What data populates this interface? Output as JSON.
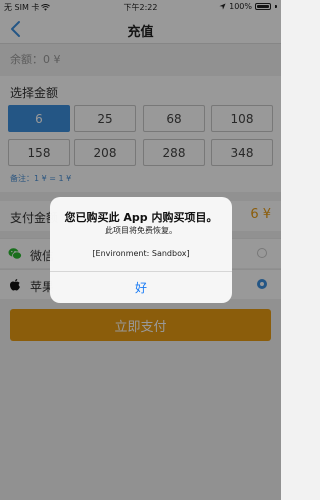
{
  "status_bar": {
    "carrier": "无 SIM 卡",
    "time": "下午2:22",
    "battery": "100%"
  },
  "nav": {
    "title": "充值",
    "back_icon": "chevron-left-icon"
  },
  "balance": {
    "label": "余额：0 ¥"
  },
  "amount_section": {
    "title": "选择金额",
    "options": [
      {
        "label": "6",
        "selected": true
      },
      {
        "label": "25",
        "selected": false
      },
      {
        "label": "68",
        "selected": false
      },
      {
        "label": "108",
        "selected": false
      },
      {
        "label": "158",
        "selected": false
      },
      {
        "label": "208",
        "selected": false
      },
      {
        "label": "288",
        "selected": false
      },
      {
        "label": "348",
        "selected": false
      }
    ],
    "note": "备注：1 ¥ = 1 ¥"
  },
  "pay_amount": {
    "label": "支付金额",
    "value": "6 ¥"
  },
  "methods": [
    {
      "label": "微信",
      "icon": "wechat-icon",
      "checked": false
    },
    {
      "label": "苹果",
      "icon": "apple-icon",
      "checked": true
    }
  ],
  "pay_button": {
    "label": "立即支付"
  },
  "alert": {
    "title": "您已购买此 App 内购买项目。",
    "message": "此项目将免费恢复。",
    "environment": "[Environment: Sandbox]",
    "button": "好"
  },
  "colors": {
    "accent": "#3d8fde",
    "pay_orange": "#e89b13",
    "alert_button_blue": "#1a7cf5"
  }
}
